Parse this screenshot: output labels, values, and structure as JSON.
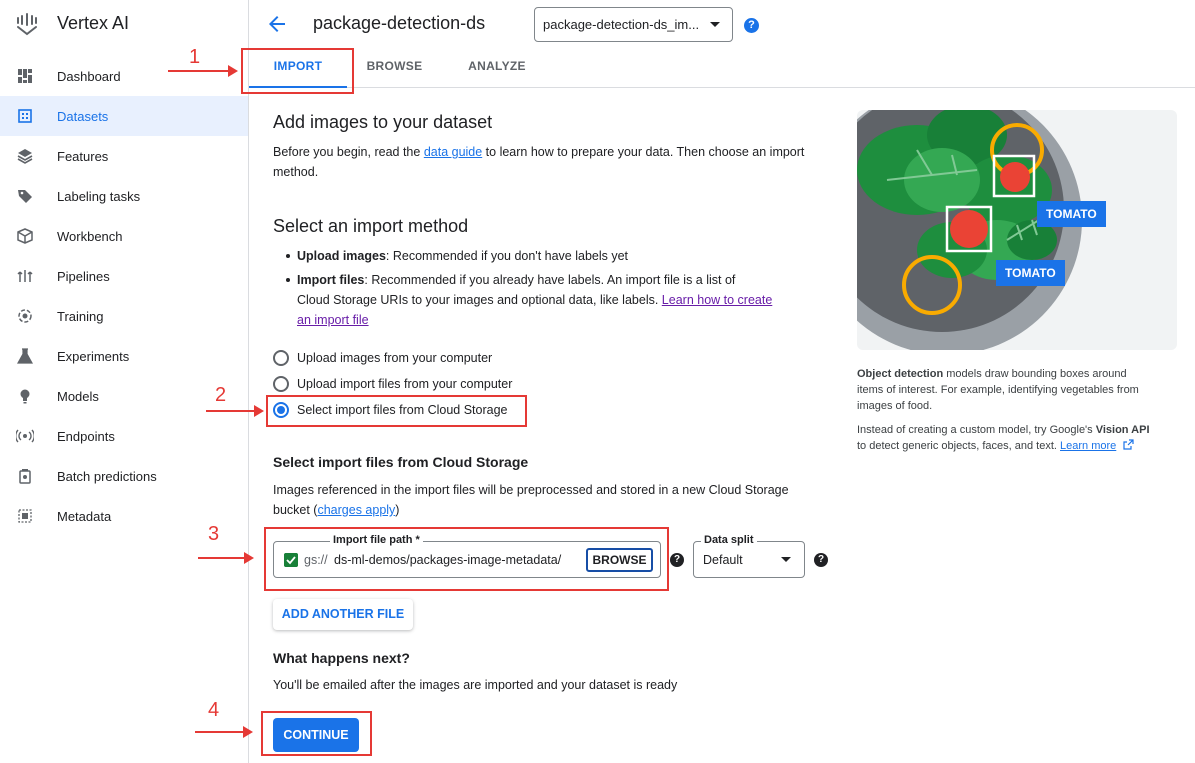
{
  "app": {
    "title": "Vertex AI"
  },
  "sidebar": {
    "items": [
      {
        "label": "Dashboard",
        "icon": "dashboard-icon",
        "active": false
      },
      {
        "label": "Datasets",
        "icon": "datasets-icon",
        "active": true
      },
      {
        "label": "Features",
        "icon": "features-icon",
        "active": false
      },
      {
        "label": "Labeling tasks",
        "icon": "tag-icon",
        "active": false
      },
      {
        "label": "Workbench",
        "icon": "workbench-icon",
        "active": false
      },
      {
        "label": "Pipelines",
        "icon": "pipelines-icon",
        "active": false
      },
      {
        "label": "Training",
        "icon": "training-icon",
        "active": false
      },
      {
        "label": "Experiments",
        "icon": "flask-icon",
        "active": false
      },
      {
        "label": "Models",
        "icon": "lightbulb-icon",
        "active": false
      },
      {
        "label": "Endpoints",
        "icon": "endpoints-icon",
        "active": false
      },
      {
        "label": "Batch predictions",
        "icon": "batch-icon",
        "active": false
      },
      {
        "label": "Metadata",
        "icon": "metadata-icon",
        "active": false
      }
    ]
  },
  "header": {
    "title": "package-detection-ds",
    "dataset_select": "package-detection-ds_im...",
    "help": "?"
  },
  "tabs": [
    {
      "label": "IMPORT",
      "active": true
    },
    {
      "label": "BROWSE",
      "active": false
    },
    {
      "label": "ANALYZE",
      "active": false
    }
  ],
  "main": {
    "heading": "Add images to your dataset",
    "intro_before": "Before you begin, read the ",
    "intro_link": "data guide",
    "intro_after": " to learn how to prepare your data. Then choose an import",
    "intro_line2": "method.",
    "method_heading": "Select an import method",
    "bullet1_bold": "Upload images",
    "bullet1_rest": ": Recommended if you don't have labels yet",
    "bullet2_bold": "Import files",
    "bullet2_rest": ": Recommended if you already have labels. An import file is a list of",
    "bullet2_line2": "Cloud Storage URIs to your images and optional data, like labels. ",
    "bullet2_link_a": "Learn how to create",
    "bullet2_link_b": "an import file",
    "radio_options": [
      {
        "label": "Upload images from your computer",
        "selected": false
      },
      {
        "label": "Upload import files from your computer",
        "selected": false
      },
      {
        "label": "Select import files from Cloud Storage",
        "selected": true
      }
    ],
    "cloud_heading": "Select import files from Cloud Storage",
    "cloud_desc_line1": "Images referenced in the import files will be preprocessed and stored in a new Cloud Storage",
    "cloud_desc_line2_before": "bucket (",
    "cloud_desc_link": "charges apply",
    "cloud_desc_line2_after": ")",
    "file_path_label": "Import file path *",
    "file_prefix": "gs://",
    "file_value": "ds-ml-demos/packages-image-metadata/",
    "browse_label": "BROWSE",
    "split_label": "Data split",
    "split_value": "Default",
    "add_file_label": "ADD ANOTHER FILE",
    "next_heading": "What happens next?",
    "next_text": "You'll be emailed after the images are imported and your dataset is ready",
    "continue_label": "CONTINUE"
  },
  "side": {
    "tag1": "TOMATO",
    "tag2": "TOMATO",
    "p1_bold": "Object detection",
    "p1_rest": " models draw bounding boxes around",
    "p1_line2": "items of interest. For example, identifying vegetables from",
    "p1_line3": "images of food.",
    "p2_line1_before": "Instead of creating a custom model, try Google's ",
    "p2_line1_bold": "Vision API",
    "p2_line2": "to detect generic objects, faces, and text. ",
    "p2_link": "Learn more"
  },
  "annotations": [
    "1",
    "2",
    "3",
    "4"
  ],
  "colors": {
    "accent": "#1a73e8",
    "annotation": "#e53935",
    "active_bg": "#e8f0fe"
  }
}
